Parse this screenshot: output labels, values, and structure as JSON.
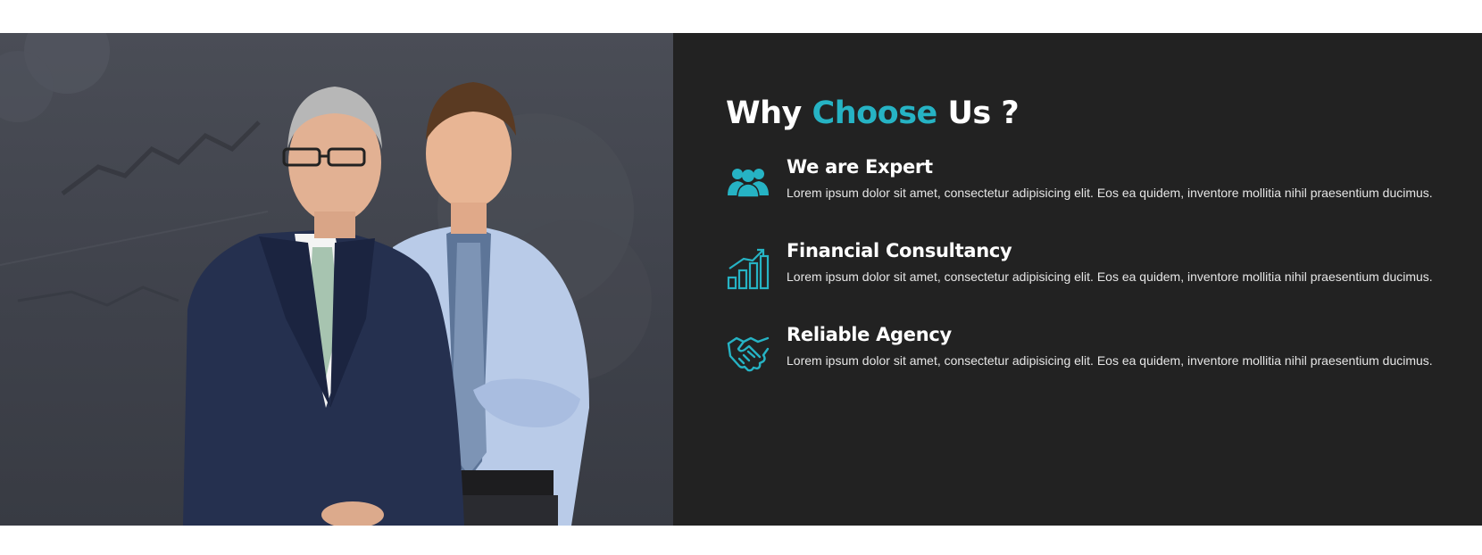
{
  "section": {
    "heading": {
      "before": "Why",
      "accent": "Choose",
      "after": "Us ?"
    },
    "accent_color": "#26b3c4",
    "left_image_alt": "Two businessmen standing in suits",
    "features": [
      {
        "icon": "team-icon",
        "title": "We are Expert",
        "text": "Lorem ipsum dolor sit amet, consectetur adipisicing elit. Eos ea quidem, inventore mollitia nihil praesentium ducimus."
      },
      {
        "icon": "growth-chart-icon",
        "title": "Financial Consultancy",
        "text": "Lorem ipsum dolor sit amet, consectetur adipisicing elit. Eos ea quidem, inventore mollitia nihil praesentium ducimus."
      },
      {
        "icon": "handshake-icon",
        "title": "Reliable Agency",
        "text": "Lorem ipsum dolor sit amet, consectetur adipisicing elit. Eos ea quidem, inventore mollitia nihil praesentium ducimus."
      }
    ]
  }
}
